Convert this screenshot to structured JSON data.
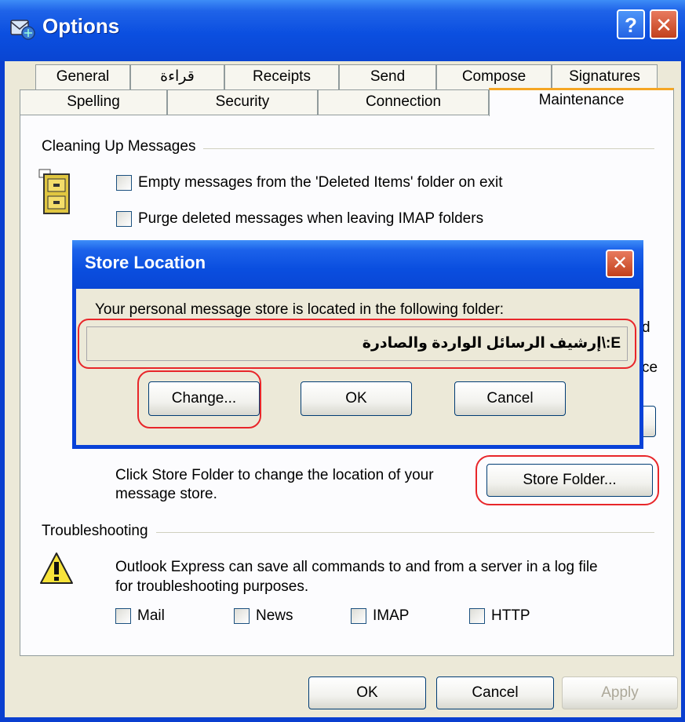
{
  "window": {
    "title": "Options",
    "help_label": "?",
    "close_label": "✕"
  },
  "tabs": {
    "row1": [
      "General",
      "قراءة",
      "Receipts",
      "Send",
      "Compose",
      "Signatures"
    ],
    "row2": [
      "Spelling",
      "Security",
      "Connection",
      "Maintenance"
    ],
    "active": "Maintenance"
  },
  "cleaning": {
    "header": "Cleaning Up Messages",
    "checkbox1": "Empty messages from the 'Deleted Items' folder on exit",
    "checkbox2": "Purge deleted messages when leaving IMAP folders",
    "partial1": "d",
    "partial2": "ce"
  },
  "store": {
    "description_line1": "Click Store Folder to change the location of your",
    "description_line2": "message store.",
    "store_folder_button": "Store Folder..."
  },
  "troubleshooting": {
    "header": "Troubleshooting",
    "description_line1": "Outlook Express can save all commands to and from a server in a log file",
    "description_line2": "for troubleshooting purposes.",
    "checkboxes": [
      "Mail",
      "News",
      "IMAP",
      "HTTP"
    ]
  },
  "footer": {
    "ok": "OK",
    "cancel": "Cancel",
    "apply": "Apply"
  },
  "dialog": {
    "title": "Store Location",
    "close_label": "✕",
    "message": "Your personal message store is located in the following folder:",
    "path": "E:\\إرشيف الرسائل الواردة والصادرة",
    "change": "Change...",
    "ok": "OK",
    "cancel": "Cancel"
  },
  "icons": {
    "title": "outlook-express-icon",
    "cleaning": "file-cabinet-icon",
    "troubleshooting": "warning-icon"
  },
  "colors": {
    "titlebar": "#0a4edf",
    "highlight_oval": "#e8262a",
    "active_tab_accent": "#f5a623"
  }
}
